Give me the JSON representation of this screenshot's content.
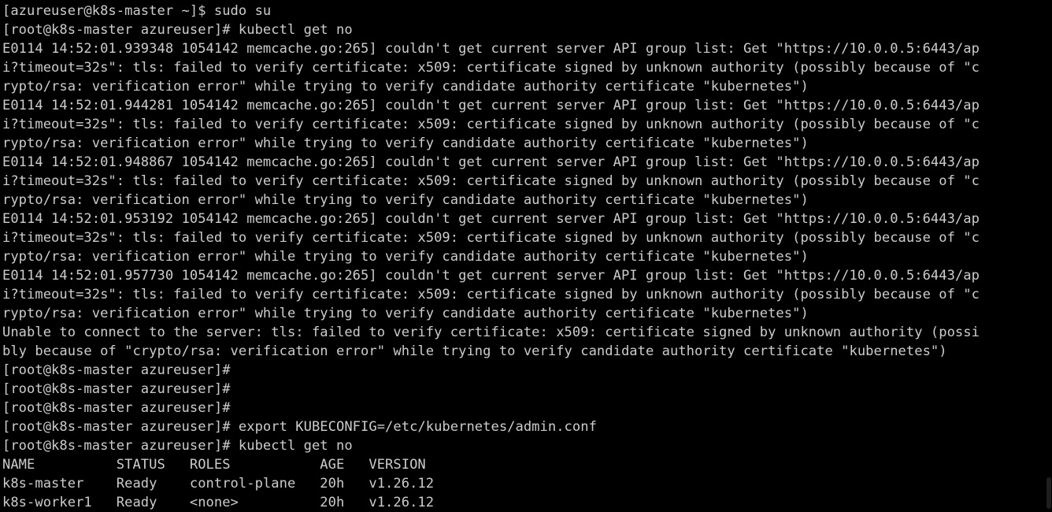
{
  "terminal": {
    "background": "#000000",
    "foreground": "#cccccc",
    "lines": [
      "[azureuser@k8s-master ~]$ sudo su",
      "[root@k8s-master azureuser]# kubectl get no",
      "E0114 14:52:01.939348 1054142 memcache.go:265] couldn't get current server API group list: Get \"https://10.0.0.5:6443/ap",
      "i?timeout=32s\": tls: failed to verify certificate: x509: certificate signed by unknown authority (possibly because of \"c",
      "rypto/rsa: verification error\" while trying to verify candidate authority certificate \"kubernetes\")",
      "E0114 14:52:01.944281 1054142 memcache.go:265] couldn't get current server API group list: Get \"https://10.0.0.5:6443/ap",
      "i?timeout=32s\": tls: failed to verify certificate: x509: certificate signed by unknown authority (possibly because of \"c",
      "rypto/rsa: verification error\" while trying to verify candidate authority certificate \"kubernetes\")",
      "E0114 14:52:01.948867 1054142 memcache.go:265] couldn't get current server API group list: Get \"https://10.0.0.5:6443/ap",
      "i?timeout=32s\": tls: failed to verify certificate: x509: certificate signed by unknown authority (possibly because of \"c",
      "rypto/rsa: verification error\" while trying to verify candidate authority certificate \"kubernetes\")",
      "E0114 14:52:01.953192 1054142 memcache.go:265] couldn't get current server API group list: Get \"https://10.0.0.5:6443/ap",
      "i?timeout=32s\": tls: failed to verify certificate: x509: certificate signed by unknown authority (possibly because of \"c",
      "rypto/rsa: verification error\" while trying to verify candidate authority certificate \"kubernetes\")",
      "E0114 14:52:01.957730 1054142 memcache.go:265] couldn't get current server API group list: Get \"https://10.0.0.5:6443/ap",
      "i?timeout=32s\": tls: failed to verify certificate: x509: certificate signed by unknown authority (possibly because of \"c",
      "rypto/rsa: verification error\" while trying to verify candidate authority certificate \"kubernetes\")",
      "Unable to connect to the server: tls: failed to verify certificate: x509: certificate signed by unknown authority (possi",
      "bly because of \"crypto/rsa: verification error\" while trying to verify candidate authority certificate \"kubernetes\")",
      "[root@k8s-master azureuser]#",
      "[root@k8s-master azureuser]#",
      "[root@k8s-master azureuser]#",
      "[root@k8s-master azureuser]# export KUBECONFIG=/etc/kubernetes/admin.conf",
      "[root@k8s-master azureuser]# kubectl get no",
      "NAME          STATUS   ROLES           AGE   VERSION",
      "k8s-master    Ready    control-plane   20h   v1.26.12",
      "k8s-worker1   Ready    <none>          20h   v1.26.12"
    ]
  }
}
